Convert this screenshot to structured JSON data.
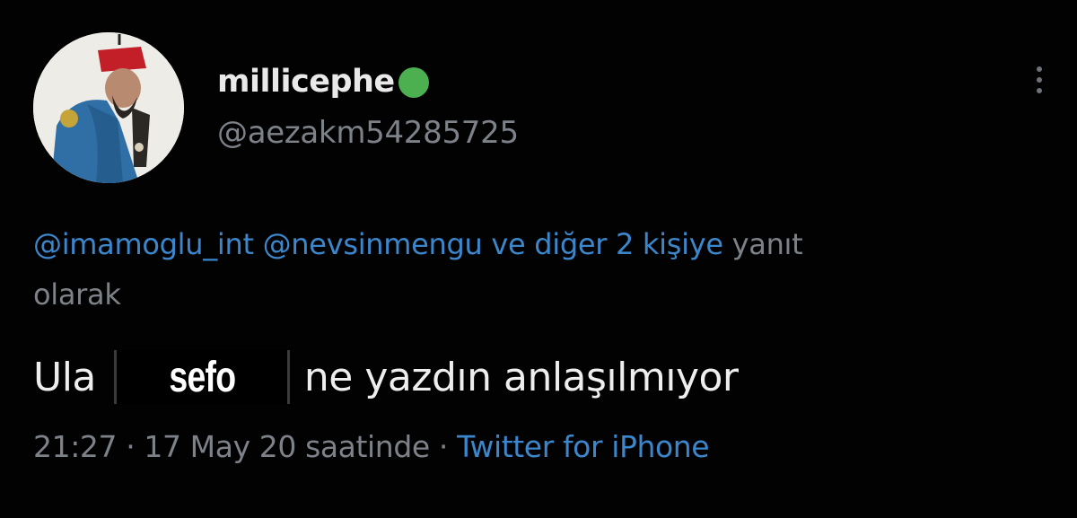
{
  "tweet": {
    "display_name": "millicephe",
    "handle": "@aezakm54285725",
    "reply": {
      "mention_1": "@imamoglu_int",
      "mention_2": "@nevsinmengu",
      "others": "ve diğer 2 kişiye",
      "suffix_1": "yanıt",
      "suffix_2": "olarak"
    },
    "text_before": "Ula",
    "redacted_word": "sefo",
    "text_after": "ne yazdın anlaşılmıyor",
    "time": "21:27",
    "date": "17 May 20 saatinde",
    "separator": "·",
    "source": "Twitter for iPhone"
  },
  "icons": {
    "verified": "verified-badge-icon",
    "more": "more-options-icon"
  },
  "colors": {
    "background": "#000000",
    "link": "#3c86cb",
    "verified": "#4caf50",
    "secondary_text": "#7d8288"
  }
}
